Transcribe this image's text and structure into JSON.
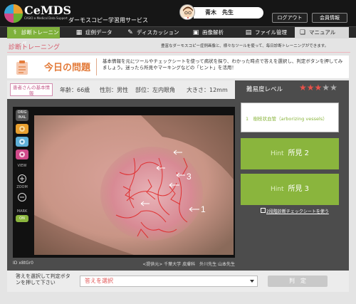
{
  "header": {
    "logo_text": "CeMDS",
    "logo_sub": "CASIO e-Medical Data Support",
    "service_name": "ダーモスコピー学習用サービス",
    "user_name": "青木　先生",
    "logout_label": "ログアウト",
    "member_label": "会員情報"
  },
  "nav": {
    "items": [
      {
        "label": "診断トレーニング",
        "icon": "stethoscope-icon"
      },
      {
        "label": "症例データ",
        "icon": "grid-icon"
      },
      {
        "label": "ディスカッション",
        "icon": "chat-icon"
      },
      {
        "label": "画像解析",
        "icon": "image-icon"
      },
      {
        "label": "ファイル管理",
        "icon": "folder-icon"
      },
      {
        "label": "マニュアル",
        "icon": "book-icon"
      }
    ]
  },
  "page": {
    "title": "診断トレーニング",
    "note": "豊富なダーモスコピー症例画像と、様々なツールを使って、毎日診断トレーニングができます。"
  },
  "question": {
    "title": "今日の問題",
    "description": "基本情報を元にツールやチェックシートを使って病状を探り、わかった時点で答えを選択し、判定ボタンを押してみましょう。迷ったら所見やマーキングなどの「ヒント」を活用！"
  },
  "patient": {
    "badge": "患者さんの基本情報",
    "age": "年齢：66歳",
    "sex": "性別：男性",
    "site": "部位：左内眼角",
    "size": "大きさ：12mm"
  },
  "viewer": {
    "tool_labels": {
      "view": "VIEW",
      "zoom": "ZOOM",
      "mark": "MARK",
      "orig": "ORIG INAL",
      "on": "ON"
    },
    "annotations": [
      "1",
      "3"
    ],
    "image_id": "ID x8tGr0",
    "credit": "<提供元> 千葉大学 皮膚科　外川先生 山本先生"
  },
  "difficulty": {
    "label": "難易度レベル",
    "level": 3,
    "max": 5,
    "filled_color": "#e8524a",
    "empty_color": "#aaaaaa"
  },
  "findings": {
    "first": "1　樹枝状血管（arborizing vessels）",
    "hints": [
      {
        "prefix": "Hint",
        "label": "所見 2"
      },
      {
        "prefix": "Hint",
        "label": "所見 3"
      }
    ],
    "check_link": "2段階診断チェックシートを使う"
  },
  "answer": {
    "prompt": "答えを選択して判定ボタンを押して下さい",
    "placeholder": "答えを選択",
    "judge_label": "判　定"
  },
  "colors": {
    "accent": "#8ab53d",
    "title": "#e37b3a",
    "crumb": "#d65a6a"
  }
}
